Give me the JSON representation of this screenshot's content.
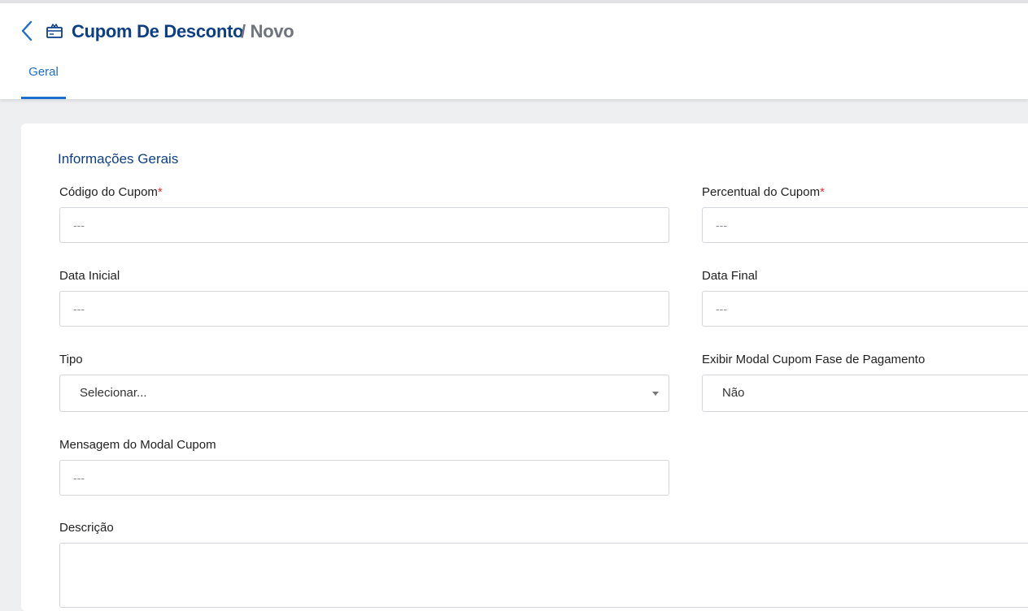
{
  "header": {
    "title": "Cupom De Desconto",
    "subtitle": "/ Novo",
    "accent_color": "#1e6ed0",
    "title_color": "#0d3f86",
    "icons": {
      "back": "chevron-left-icon",
      "ticket": "ticket-icon"
    }
  },
  "tabs": [
    {
      "label": "Geral",
      "active": true
    }
  ],
  "form": {
    "section_title": "Informações Gerais",
    "codigo": {
      "label": "Código do Cupom",
      "required_mark": "*",
      "placeholder": "---"
    },
    "percentual": {
      "label": "Percentual do Cupom",
      "required_mark": "*",
      "placeholder": "---"
    },
    "data_inicial": {
      "label": "Data Inicial",
      "placeholder": "---"
    },
    "data_final": {
      "label": "Data Final",
      "placeholder": "---"
    },
    "tipo": {
      "label": "Tipo",
      "value": "Selecionar..."
    },
    "exibir_modal": {
      "label": "Exibir Modal Cupom Fase de Pagamento",
      "value": "Não"
    },
    "mensagem_modal": {
      "label": "Mensagem do Modal Cupom",
      "placeholder": "---"
    },
    "descricao": {
      "label": "Descrição"
    }
  },
  "colors": {
    "required": "#e0312e",
    "background": "#eeeff1"
  }
}
